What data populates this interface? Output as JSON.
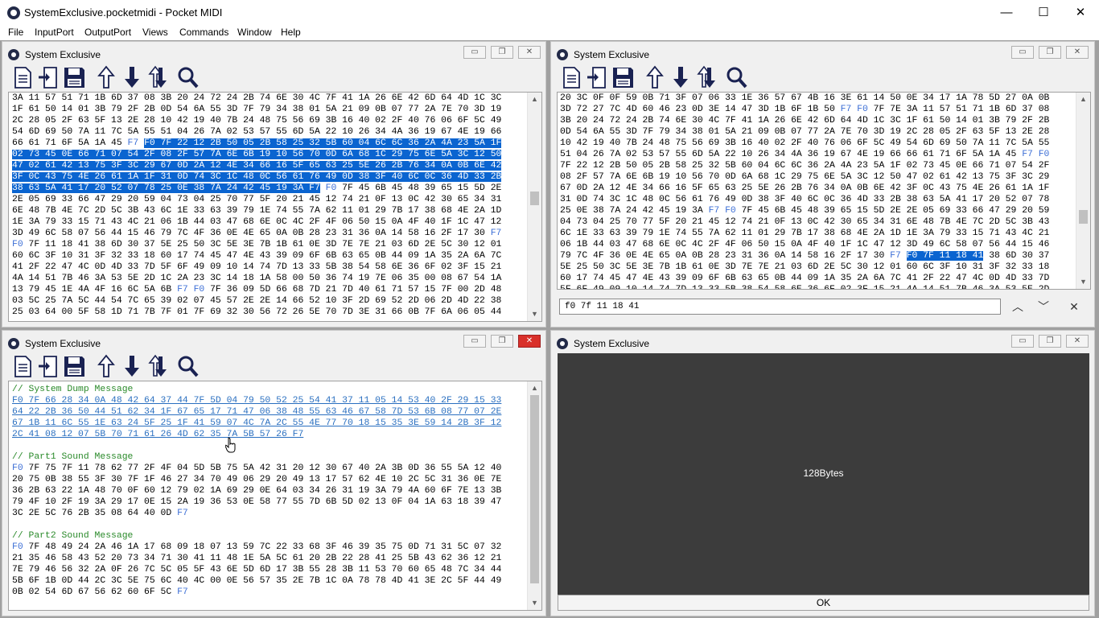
{
  "app": {
    "title": "SystemExclusive.pocketmidi - Pocket MIDI",
    "minimize": "—",
    "maximize": "☐",
    "close": "✕"
  },
  "menu": [
    "File",
    "InputPort",
    "OutputPort",
    "Views",
    "Commands",
    "Window",
    "Help"
  ],
  "windows": {
    "top_left": {
      "title": "System Exclusive",
      "lines": [
        [
          [
            "3A 11 57 51 71 1B 6D 37 08 3B 20 24 72 24 2B 74 6E 30 4C 7F 41 1A 26 6E 42 6D 64 4D 1C 3C",
            ""
          ]
        ],
        [
          [
            "1F 61 50 14 01 3B 79 2F 2B 0D 54 6A 55 3D 7F 79 34 38 01 5A 21 09 0B 07 77 2A 7E 70 3D 19",
            ""
          ]
        ],
        [
          [
            "2C 28 05 2F 63 5F 13 2E 28 10 42 19 40 7B 24 48 75 56 69 3B 16 40 02 2F 40 76 06 6F 5C 49",
            ""
          ]
        ],
        [
          [
            "54 6D 69 50 7A 11 7C 5A 55 51 04 26 7A 02 53 57 55 6D 5A 22 10 26 34 4A 36 19 67 4E 19 66",
            ""
          ]
        ],
        [
          [
            "66 61 71 6F 5A 1A 45 ",
            ""
          ],
          [
            "F7",
            "mk"
          ],
          [
            " ",
            ""
          ],
          [
            "F0 7F 22 12 2B 50 05 2B 58 25 32 5B 60 04 6C 6C 36 2A 4A 23 5A 1F",
            "sel"
          ]
        ],
        [
          [
            "02 73 45 0E 66 71 07 54 2F 08 2F 57 7A 6E 6B 19 10 56 70 0D 6A 68 1C 29 75 6E 5A 3C 12 50",
            "sel"
          ]
        ],
        [
          [
            "47 02 61 42 13 75 3F 3C 29 67 0D 2A 12 4E 34 66 16 5F 65 63 25 5E 26 2B 76 34 0A 0B 6E 42",
            "sel"
          ]
        ],
        [
          [
            "3F 0C 43 75 4E 26 61 1A 1F 31 0D 74 3C 1C 48 0C 56 61 76 49 0D 38 3F 40 6C 0C 36 4D 33 2B",
            "sel"
          ]
        ],
        [
          [
            "38 63 5A 41 17 20 52 07 78 25 0E 38 7A 24 42 45 19 3A F7",
            "sel"
          ],
          [
            " ",
            ""
          ],
          [
            "F0",
            "mk"
          ],
          [
            " 7F 45 6B 45 48 39 65 15 5D 2E",
            ""
          ]
        ],
        [
          [
            "2E 05 69 33 66 47 29 20 59 04 73 04 25 70 77 5F 20 21 45 12 74 21 0F 13 0C 42 30 65 34 31",
            ""
          ]
        ],
        [
          [
            "6E 48 7B 4E 7C 2D 5C 3B 43 6C 1E 33 63 39 79 1E 74 55 7A 62 11 01 29 7B 17 38 68 4E 2A 1D",
            ""
          ]
        ],
        [
          [
            "1E 3A 79 33 15 71 43 4C 21 06 1B 44 03 47 68 6E 0C 4C 2F 4F 06 50 15 0A 4F 40 1F 1C 47 12",
            ""
          ]
        ],
        [
          [
            "3D 49 6C 58 07 56 44 15 46 79 7C 4F 36 0E 4E 65 0A 0B 28 23 31 36 0A 14 58 16 2F 17 30 ",
            ""
          ],
          [
            "F7",
            "mk"
          ]
        ],
        [
          [
            "F0",
            "mk"
          ],
          [
            " 7F 11 18 41 38 6D 30 37 5E 25 50 3C 5E 3E 7B 1B 61 0E 3D 7E 7E 21 03 6D 2E 5C 30 12 01",
            ""
          ]
        ],
        [
          [
            "60 6C 3F 10 31 3F 32 33 18 60 17 74 45 47 4E 43 39 09 6F 6B 63 65 0B 44 09 1A 35 2A 6A 7C",
            ""
          ]
        ],
        [
          [
            "41 2F 22 47 4C 0D 4D 33 7D 5F 6F 49 09 10 14 74 7D 13 33 5B 38 54 58 6E 36 6F 02 3F 15 21",
            ""
          ]
        ],
        [
          [
            "4A 14 51 7B 46 3A 53 5E 2D 1C 2A 23 3C 14 18 1A 58 00 50 36 74 19 7E 06 35 00 08 67 54 1A",
            ""
          ]
        ],
        [
          [
            "13 79 45 1E 4A 4F 16 6C 5A 6B ",
            ""
          ],
          [
            "F7 F0",
            "mk"
          ],
          [
            " 7F 36 09 5D 66 68 7D 21 7D 40 61 71 57 15 7F 00 2D 48",
            ""
          ]
        ],
        [
          [
            "03 5C 25 7A 5C 44 54 7C 65 39 02 07 45 57 2E 2E 14 66 52 10 3F 2D 69 52 2D 06 2D 4D 22 38",
            ""
          ]
        ],
        [
          [
            "25 03 64 00 5F 58 1D 71 7B 7F 01 7F 69 32 30 56 72 26 5E 70 7D 3E 31 66 0B 7F 6A 06 05 44",
            ""
          ]
        ]
      ]
    },
    "top_right": {
      "title": "System Exclusive",
      "lines": [
        [
          [
            "20 3C 0F 0F 59 0B 71 3F 07 06 33 1E 36 57 67 4B 16 3E 61 14 50 0E 34 17 1A 78 5D 27 0A 0B",
            ""
          ]
        ],
        [
          [
            "3D 72 27 7C 4D 60 46 23 0D 3E 14 47 3D 1B 6F 1B 50 ",
            ""
          ],
          [
            "F7 F0",
            "mk"
          ],
          [
            " 7F 7E 3A 11 57 51 71 1B 6D 37 08",
            ""
          ]
        ],
        [
          [
            "3B 20 24 72 24 2B 74 6E 30 4C 7F 41 1A 26 6E 42 6D 64 4D 1C 3C 1F 61 50 14 01 3B 79 2F 2B",
            ""
          ]
        ],
        [
          [
            "0D 54 6A 55 3D 7F 79 34 38 01 5A 21 09 0B 07 77 2A 7E 70 3D 19 2C 28 05 2F 63 5F 13 2E 28",
            ""
          ]
        ],
        [
          [
            "10 42 19 40 7B 24 48 75 56 69 3B 16 40 02 2F 40 76 06 6F 5C 49 54 6D 69 50 7A 11 7C 5A 55",
            ""
          ]
        ],
        [
          [
            "51 04 26 7A 02 53 57 55 6D 5A 22 10 26 34 4A 36 19 67 4E 19 66 66 61 71 6F 5A 1A 45 ",
            ""
          ],
          [
            "F7 F0",
            "mk"
          ]
        ],
        [
          [
            "7F 22 12 2B 50 05 2B 58 25 32 5B 60 04 6C 6C 36 2A 4A 23 5A 1F 02 73 45 0E 66 71 07 54 2F",
            ""
          ]
        ],
        [
          [
            "08 2F 57 7A 6E 6B 19 10 56 70 0D 6A 68 1C 29 75 6E 5A 3C 12 50 47 02 61 42 13 75 3F 3C 29",
            ""
          ]
        ],
        [
          [
            "67 0D 2A 12 4E 34 66 16 5F 65 63 25 5E 26 2B 76 34 0A 0B 6E 42 3F 0C 43 75 4E 26 61 1A 1F",
            ""
          ]
        ],
        [
          [
            "31 0D 74 3C 1C 48 0C 56 61 76 49 0D 38 3F 40 6C 0C 36 4D 33 2B 38 63 5A 41 17 20 52 07 78",
            ""
          ]
        ],
        [
          [
            "25 0E 38 7A 24 42 45 19 3A ",
            ""
          ],
          [
            "F7 F0",
            "mk"
          ],
          [
            " 7F 45 6B 45 48 39 65 15 5D 2E 2E 05 69 33 66 47 29 20 59",
            ""
          ]
        ],
        [
          [
            "04 73 04 25 70 77 5F 20 21 45 12 74 21 0F 13 0C 42 30 65 34 31 6E 48 7B 4E 7C 2D 5C 3B 43",
            ""
          ]
        ],
        [
          [
            "6C 1E 33 63 39 79 1E 74 55 7A 62 11 01 29 7B 17 38 68 4E 2A 1D 1E 3A 79 33 15 71 43 4C 21",
            ""
          ]
        ],
        [
          [
            "06 1B 44 03 47 68 6E 0C 4C 2F 4F 06 50 15 0A 4F 40 1F 1C 47 12 3D 49 6C 58 07 56 44 15 46",
            ""
          ]
        ],
        [
          [
            "79 7C 4F 36 0E 4E 65 0A 0B 28 23 31 36 0A 14 58 16 2F 17 30 ",
            ""
          ],
          [
            "F7",
            "mk"
          ],
          [
            " ",
            ""
          ],
          [
            "F0 7F 11 18 41",
            "sel"
          ],
          [
            " 38 6D 30 37",
            ""
          ]
        ],
        [
          [
            "5E 25 50 3C 5E 3E 7B 1B 61 0E 3D 7E 7E 21 03 6D 2E 5C 30 12 01 60 6C 3F 10 31 3F 32 33 18",
            ""
          ]
        ],
        [
          [
            "60 17 74 45 47 4E 43 39 09 6F 6B 63 65 0B 44 09 1A 35 2A 6A 7C 41 2F 22 47 4C 0D 4D 33 7D",
            ""
          ]
        ],
        [
          [
            "5F 6F 49 09 10 14 74 7D 13 33 5B 38 54 58 6E 36 6F 02 3F 15 21 4A 14 51 7B 46 3A 53 5E 2D",
            ""
          ]
        ]
      ],
      "search_value": "f0 7f 11 18 41",
      "search_prev": "︿",
      "search_next": "﹀",
      "search_close": "✕"
    },
    "bottom_left": {
      "title": "System Exclusive",
      "lines": [
        [
          [
            "// System Dump Message",
            "cm"
          ]
        ],
        [
          [
            "F0 7F 66 28 34 0A 48 42 64 37 44 7F 5D 04 79 50 52 25 54 41 37 11 05 14 53 40 2F 29 15 33",
            "lk"
          ]
        ],
        [
          [
            "64 22 2B 36 50 44 51 62 34 1F 67 65 17 71 47 06 38 48 55 63 46 67 58 7D 53 6B 08 77 07 2E",
            "lk"
          ]
        ],
        [
          [
            "67 1B 11 6C 55 1E 63 24 5F 25 1F 41 59 07 4C 7A 2C 55 4E 77 70 18 15 35 3E 59 14 2B 3F 12",
            "lk"
          ]
        ],
        [
          [
            "2C 41 08 12 07 5B 70 71 61 26 4D 62 35 7A 5B 57 26 F7",
            "lk"
          ]
        ],
        [
          [
            "",
            ""
          ]
        ],
        [
          [
            "// Part1 Sound Message",
            "cm"
          ]
        ],
        [
          [
            "F0",
            "mk"
          ],
          [
            " 7F 75 7F 11 78 62 77 2F 4F 04 5D 5B 75 5A 42 31 20 12 30 67 40 2A 3B 0D 36 55 5A 12 40",
            ""
          ]
        ],
        [
          [
            "20 75 0B 38 55 3F 30 7F 1F 46 27 34 70 49 06 29 20 49 13 17 57 62 4E 10 2C 5C 31 36 0E 7E",
            ""
          ]
        ],
        [
          [
            "36 2B 63 22 1A 48 70 0F 60 12 79 02 1A 69 29 0E 64 03 34 26 31 19 3A 79 4A 60 6F 7E 13 3B",
            ""
          ]
        ],
        [
          [
            "79 4F 10 2F 19 3A 29 17 0E 15 2A 19 36 53 0E 58 77 55 7D 6B 5D 02 13 0F 04 1A 63 18 39 47",
            ""
          ]
        ],
        [
          [
            "3C 2E 5C 76 2B 35 08 64 40 0D ",
            ""
          ],
          [
            "F7",
            "mk"
          ]
        ],
        [
          [
            "",
            ""
          ]
        ],
        [
          [
            "// Part2 Sound Message",
            "cm"
          ]
        ],
        [
          [
            "F0",
            "mk"
          ],
          [
            " 7F 48 49 24 2A 46 1A 17 68 09 18 07 13 59 7C 22 33 68 3F 46 39 35 75 0D 71 31 5C 07 32",
            ""
          ]
        ],
        [
          [
            "21 35 46 58 43 52 20 73 34 71 30 41 11 48 1E 5A 5C 61 20 2B 22 28 41 25 5B 43 62 36 12 21",
            ""
          ]
        ],
        [
          [
            "7E 79 46 56 32 2A 0F 26 7C 5C 05 5F 43 6E 5D 6D 17 3B 55 28 3B 11 53 70 60 65 48 7C 34 44",
            ""
          ]
        ],
        [
          [
            "5B 6F 1B 0D 44 2C 3C 5E 75 6C 40 4C 00 0E 56 57 35 2E 7B 1C 0A 78 78 4D 41 3E 2C 5F 44 49",
            ""
          ]
        ],
        [
          [
            "0B 02 54 6D 67 56 62 60 6F 5C ",
            ""
          ],
          [
            "F7",
            "mk"
          ]
        ]
      ]
    },
    "bottom_right": {
      "title": "System Exclusive",
      "byte_count": "128Bytes",
      "ok_label": "OK"
    }
  }
}
